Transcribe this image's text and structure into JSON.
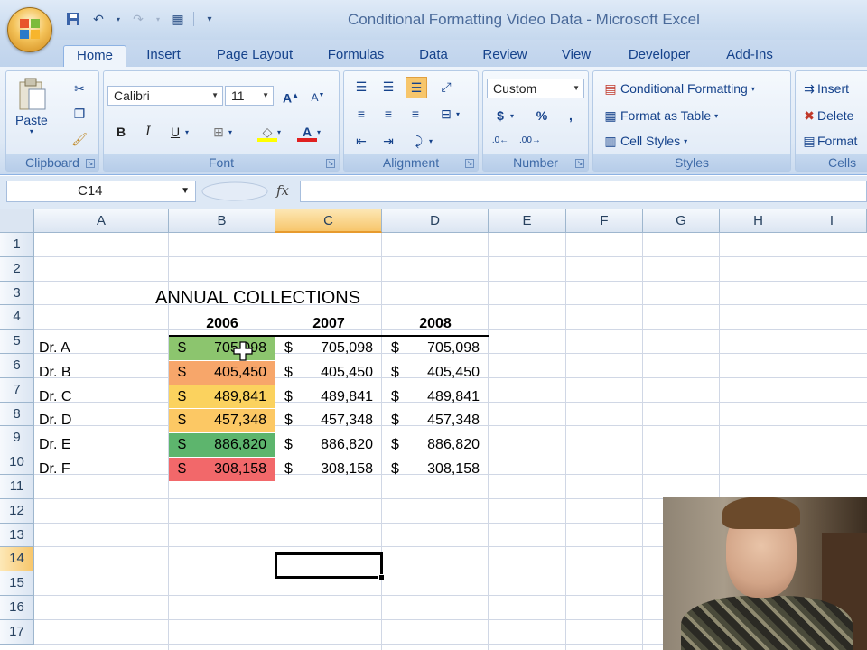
{
  "window": {
    "title": "Conditional Formatting Video Data - Microsoft Excel"
  },
  "tabs": [
    "Home",
    "Insert",
    "Page Layout",
    "Formulas",
    "Data",
    "Review",
    "View",
    "Developer",
    "Add-Ins"
  ],
  "active_tab": "Home",
  "ribbon": {
    "clipboard": {
      "label": "Clipboard",
      "paste": "Paste"
    },
    "font": {
      "label": "Font",
      "name": "Calibri",
      "size": "11",
      "bold": "B",
      "italic": "I",
      "underline": "U"
    },
    "alignment": {
      "label": "Alignment"
    },
    "number": {
      "label": "Number",
      "format": "Custom",
      "currency": "$",
      "percent": "%",
      "comma": ","
    },
    "styles": {
      "label": "Styles",
      "conditional": "Conditional Formatting",
      "format_table": "Format as Table",
      "cell_styles": "Cell Styles"
    },
    "cells": {
      "label": "Cells",
      "insert": "Insert",
      "delete": "Delete",
      "format": "Format"
    }
  },
  "formula_bar": {
    "name_box": "C14",
    "fx": "fx",
    "value": ""
  },
  "columns": [
    "A",
    "B",
    "C",
    "D",
    "E",
    "F",
    "G",
    "H",
    "I"
  ],
  "rows": [
    "1",
    "2",
    "3",
    "4",
    "5",
    "6",
    "7",
    "8",
    "9",
    "10",
    "11",
    "12",
    "13",
    "14",
    "15",
    "16",
    "17"
  ],
  "sheet": {
    "title": "ANNUAL COLLECTIONS",
    "years": [
      "2006",
      "2007",
      "2008"
    ],
    "records": [
      {
        "name": "Dr. A",
        "v2006": "705,098",
        "v2007": "705,098",
        "v2008": "705,098",
        "color": "#8cc56e"
      },
      {
        "name": "Dr. B",
        "v2006": "405,450",
        "v2007": "405,450",
        "v2008": "405,450",
        "color": "#f7a66a"
      },
      {
        "name": "Dr. C",
        "v2006": "489,841",
        "v2007": "489,841",
        "v2008": "489,841",
        "color": "#fbd25e"
      },
      {
        "name": "Dr. D",
        "v2006": "457,348",
        "v2007": "457,348",
        "v2008": "457,348",
        "color": "#fcc864"
      },
      {
        "name": "Dr. E",
        "v2006": "886,820",
        "v2007": "886,820",
        "v2008": "886,820",
        "color": "#5db56d"
      },
      {
        "name": "Dr. F",
        "v2006": "308,158",
        "v2007": "308,158",
        "v2008": "308,158",
        "color": "#f2686a"
      }
    ],
    "currency_symbol": "$"
  },
  "selected_cell": "C14"
}
